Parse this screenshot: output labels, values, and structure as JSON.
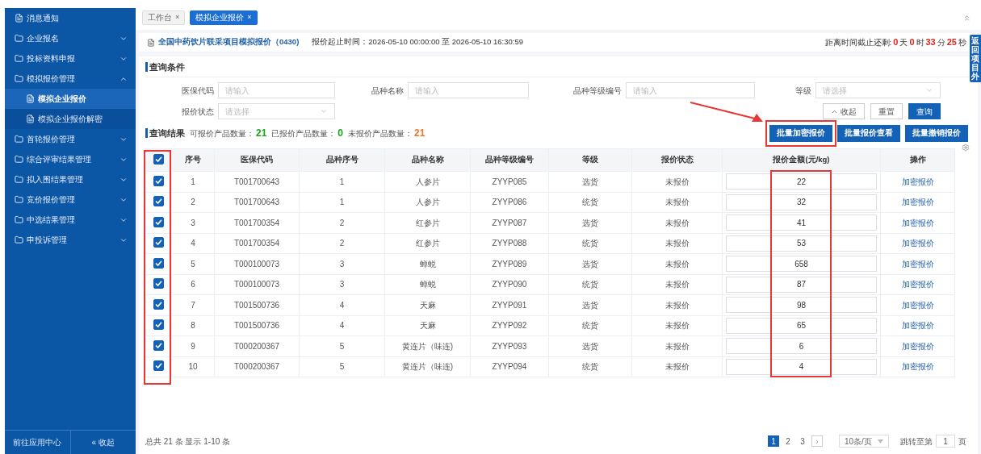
{
  "sidebar": {
    "items": [
      {
        "label": "消息通知",
        "kind": "page"
      },
      {
        "label": "企业报名",
        "kind": "folder",
        "expanded": false
      },
      {
        "label": "投标资料申报",
        "kind": "folder",
        "expanded": false
      },
      {
        "label": "模拟报价管理",
        "kind": "folder",
        "expanded": true,
        "children": [
          {
            "label": "模拟企业报价",
            "selected": true
          },
          {
            "label": "模拟企业报价解密",
            "selected": false
          }
        ]
      },
      {
        "label": "首轮报价管理",
        "kind": "folder",
        "expanded": false
      },
      {
        "label": "综合评审结果管理",
        "kind": "folder",
        "expanded": false
      },
      {
        "label": "拟入围结果管理",
        "kind": "folder",
        "expanded": false
      },
      {
        "label": "竞价报价管理",
        "kind": "folder",
        "expanded": false
      },
      {
        "label": "中选结果管理",
        "kind": "folder",
        "expanded": false
      },
      {
        "label": "申投诉管理",
        "kind": "folder",
        "expanded": false
      }
    ],
    "footer": [
      "前往应用中心",
      "« 收起"
    ]
  },
  "tabs": [
    {
      "label": "工作台",
      "close": "×",
      "selected": false
    },
    {
      "label": "模拟企业报价",
      "close": "×",
      "selected": true
    }
  ],
  "header": {
    "title": "全国中药饮片联采项目模拟报价（0430)",
    "period": "报价起止时间：2026-05-10 00:00:00 至 2026-05-10 16:30:59",
    "countdown": [
      {
        "text": "距离时间截止还剩:",
        "kind": "label"
      },
      {
        "text": "0",
        "kind": "num"
      },
      {
        "text": "天",
        "kind": "label"
      },
      {
        "text": "0",
        "kind": "num"
      },
      {
        "text": "时",
        "kind": "label"
      },
      {
        "text": "33",
        "kind": "num"
      },
      {
        "text": "分",
        "kind": "label"
      },
      {
        "text": "25",
        "kind": "num"
      },
      {
        "text": "秒",
        "kind": "label"
      }
    ]
  },
  "side_tab": "返回项目外",
  "query": {
    "title": "查询条件",
    "fields": [
      {
        "label": "医保代码",
        "placeholder": "请输入",
        "kind": "input"
      },
      {
        "label": "品种名称",
        "placeholder": "请输入",
        "kind": "input"
      },
      {
        "label": "品种等级编号",
        "placeholder": "请输入",
        "kind": "input"
      },
      {
        "label": "等级",
        "placeholder": "请选择",
        "kind": "select"
      },
      {
        "label": "报价状态",
        "placeholder": "请选择",
        "kind": "select"
      }
    ],
    "buttons": [
      {
        "label": "收起",
        "kind": "collapse"
      },
      {
        "label": "重置",
        "kind": "plain"
      },
      {
        "label": "查询",
        "kind": "primary"
      }
    ]
  },
  "results": {
    "title": "查询结果",
    "stats": [
      {
        "label": "可报价产品数量：",
        "value": "21",
        "color": "#1aa31a"
      },
      {
        "label": "已报价产品数量：",
        "value": "0",
        "color": "#1aa31a"
      },
      {
        "label": "未报价产品数量：",
        "value": "21",
        "color": "#e8772e"
      }
    ],
    "buttons": [
      {
        "label": "批量加密报价",
        "highlighted": true
      },
      {
        "label": "批量报价查看",
        "highlighted": false
      },
      {
        "label": "批量撤销报价",
        "highlighted": false
      }
    ]
  },
  "table": {
    "all_checked": true,
    "checkbox_column_highlighted": true,
    "columns": [
      {
        "label": "序号",
        "highlighted": false
      },
      {
        "label": "医保代码",
        "highlighted": false
      },
      {
        "label": "品种序号",
        "highlighted": false
      },
      {
        "label": "品种名称",
        "highlighted": false
      },
      {
        "label": "品种等级编号",
        "highlighted": false
      },
      {
        "label": "等级",
        "highlighted": false
      },
      {
        "label": "报价状态",
        "highlighted": false
      },
      {
        "label": "报价金额(元/kg)",
        "highlighted": true
      },
      {
        "label": "操作",
        "highlighted": false
      }
    ],
    "rows": [
      {
        "checked": true,
        "cells": [
          "1",
          "T001700643",
          "1",
          "人参片",
          "ZYYP085",
          "选货",
          "未报价"
        ],
        "price": "22",
        "action": "加密报价"
      },
      {
        "checked": true,
        "cells": [
          "2",
          "T001700643",
          "1",
          "人参片",
          "ZYYP086",
          "统货",
          "未报价"
        ],
        "price": "32",
        "action": "加密报价"
      },
      {
        "checked": true,
        "cells": [
          "3",
          "T001700354",
          "2",
          "红参片",
          "ZYYP087",
          "选货",
          "未报价"
        ],
        "price": "41",
        "action": "加密报价"
      },
      {
        "checked": true,
        "cells": [
          "4",
          "T001700354",
          "2",
          "红参片",
          "ZYYP088",
          "统货",
          "未报价"
        ],
        "price": "53",
        "action": "加密报价"
      },
      {
        "checked": true,
        "cells": [
          "5",
          "T000100073",
          "3",
          "蝉蜕",
          "ZYYP089",
          "选货",
          "未报价"
        ],
        "price": "658",
        "action": "加密报价"
      },
      {
        "checked": true,
        "cells": [
          "6",
          "T000100073",
          "3",
          "蝉蜕",
          "ZYYP090",
          "统货",
          "未报价"
        ],
        "price": "87",
        "action": "加密报价"
      },
      {
        "checked": true,
        "cells": [
          "7",
          "T001500736",
          "4",
          "天麻",
          "ZYYP091",
          "选货",
          "未报价"
        ],
        "price": "98",
        "action": "加密报价"
      },
      {
        "checked": true,
        "cells": [
          "8",
          "T001500736",
          "4",
          "天麻",
          "ZYYP092",
          "统货",
          "未报价"
        ],
        "price": "65",
        "action": "加密报价"
      },
      {
        "checked": true,
        "cells": [
          "9",
          "T000200367",
          "5",
          "黄连片（味连)",
          "ZYYP093",
          "选货",
          "未报价"
        ],
        "price": "6",
        "action": "加密报价"
      },
      {
        "checked": true,
        "cells": [
          "10",
          "T000200367",
          "5",
          "黄连片（味连)",
          "ZYYP094",
          "统货",
          "未报价"
        ],
        "price": "4",
        "action": "加密报价"
      }
    ]
  },
  "pagination": {
    "summary": "总共 21 条 显示 1-10 条",
    "pages": [
      {
        "label": "1",
        "selected": true
      },
      {
        "label": "2",
        "selected": false
      },
      {
        "label": "3",
        "selected": false
      }
    ],
    "next": "›",
    "page_size": "10条/页",
    "jump_label": "跳转至第",
    "jump_value": "1",
    "jump_suffix": "页"
  }
}
